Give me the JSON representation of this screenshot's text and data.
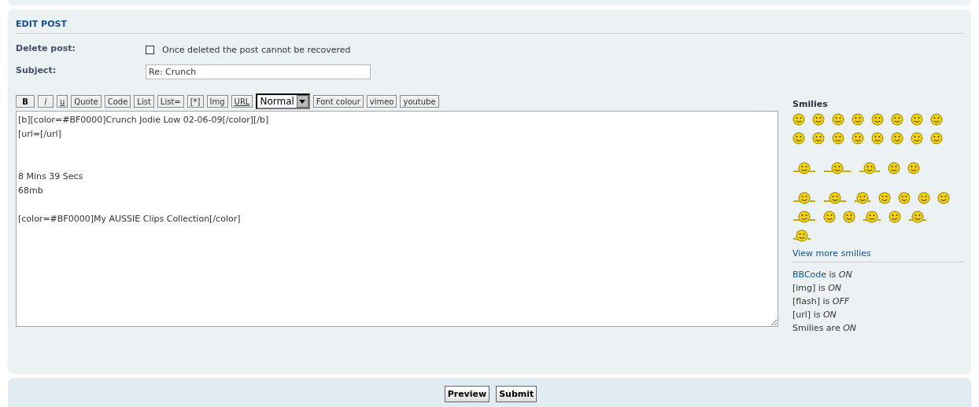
{
  "panel": {
    "title": "EDIT POST"
  },
  "delete_post": {
    "label": "Delete post:",
    "checked": false,
    "text": "Once deleted the post cannot be recovered"
  },
  "subject": {
    "label": "Subject:",
    "value": "Re: Crunch"
  },
  "toolbar": [
    {
      "label": "B",
      "kind": "bold"
    },
    {
      "label": "i",
      "kind": "italic"
    },
    {
      "label": "u",
      "kind": "underline"
    },
    {
      "label": "Quote",
      "kind": "plain"
    },
    {
      "label": "Code",
      "kind": "plain"
    },
    {
      "label": "List",
      "kind": "plain"
    },
    {
      "label": "List=",
      "kind": "plain"
    },
    {
      "label": "[*]",
      "kind": "plain"
    },
    {
      "label": "Img",
      "kind": "plain"
    },
    {
      "label": "URL",
      "kind": "underline"
    },
    {
      "label": "Normal",
      "kind": "select"
    },
    {
      "label": "Font colour",
      "kind": "plain"
    },
    {
      "label": "vimeo",
      "kind": "plain"
    },
    {
      "label": "youtube",
      "kind": "plain"
    }
  ],
  "message": "[b][color=#BF0000]Crunch Jodie Low 02-06-09[/color][/b]\n[url=[/url]\n\n\n8 Mins 39 Secs\n68mb\n\n[color=#BF0000]My AUSSIE Clips Collection[/color]",
  "smilies": {
    "title": "Smilies",
    "more_link": "View more smilies"
  },
  "options": [
    {
      "link": "BBCode",
      "text": " is *ON*"
    },
    {
      "text": "[img] is *ON*"
    },
    {
      "text": "[flash] is *OFF*"
    },
    {
      "text": "[url] is *ON*"
    },
    {
      "text": "Smilies are *ON*"
    }
  ],
  "buttons": [
    "Preview",
    "Submit"
  ]
}
